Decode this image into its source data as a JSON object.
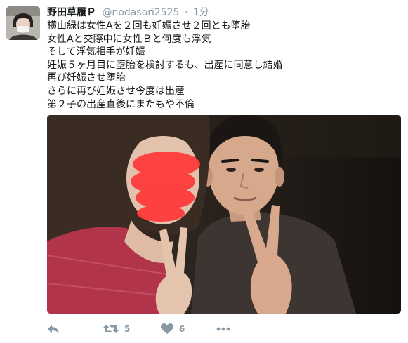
{
  "tweet": {
    "author": {
      "display_name": "野田草履Ｐ",
      "screen_name": "@nodasori2525",
      "avatar_icon": "user-avatar"
    },
    "separator": "·",
    "timestamp": "1分",
    "text_lines": [
      "横山緑は女性Aを２回も妊娠させ２回とも堕胎",
      "女性Aと交際中に女性Ｂと何度も浮気",
      "そして浮気相手が妊娠",
      "妊娠５ヶ月目に堕胎を検討するも、出産に同意し結婚",
      "再び妊娠させ堕胎",
      "さらに再び妊娠させ今度は出産",
      "第２子の出産直後にまたもや不倫"
    ],
    "media": {
      "type": "photo",
      "description_icon": "photo-two-people-peace-sign"
    },
    "actions": {
      "reply_icon": "reply-icon",
      "retweet_icon": "retweet-icon",
      "retweet_count": "5",
      "like_icon": "heart-icon",
      "like_count": "6",
      "more_icon": "more-icon"
    },
    "colors": {
      "text": "#14171a",
      "secondary": "#8899a6"
    }
  }
}
